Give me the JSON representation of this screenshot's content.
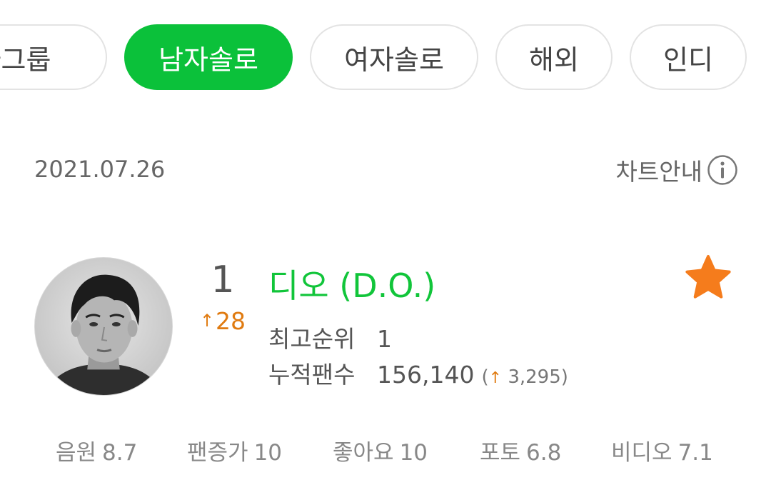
{
  "categories": [
    {
      "label": "자그룹",
      "active": false
    },
    {
      "label": "남자솔로",
      "active": true
    },
    {
      "label": "여자솔로",
      "active": false
    },
    {
      "label": "해외",
      "active": false
    },
    {
      "label": "인디",
      "active": false
    }
  ],
  "chart": {
    "date": "2021.07.26",
    "guide_label": "차트안내",
    "guide_icon": "info-icon"
  },
  "entry": {
    "rank": "1",
    "rank_change_arrow": "↑",
    "rank_change": "28",
    "artist_name": "디오 (D.O.)",
    "best_rank_label": "최고순위",
    "best_rank_value": "1",
    "fans_label": "누적팬수",
    "fans_value": "156,140",
    "fans_delta_open": "(",
    "fans_delta_arrow": "↑",
    "fans_delta": "3,295)",
    "favorite_icon": "star-icon",
    "colors": {
      "accent_green": "#0bc13a",
      "change_orange": "#e07b11",
      "star_orange": "#f57c1c"
    }
  },
  "scores": [
    {
      "label": "음원",
      "value": "8.7"
    },
    {
      "label": "팬증가",
      "value": "10"
    },
    {
      "label": "좋아요",
      "value": "10"
    },
    {
      "label": "포토",
      "value": "6.8"
    },
    {
      "label": "비디오",
      "value": "7.1"
    }
  ]
}
